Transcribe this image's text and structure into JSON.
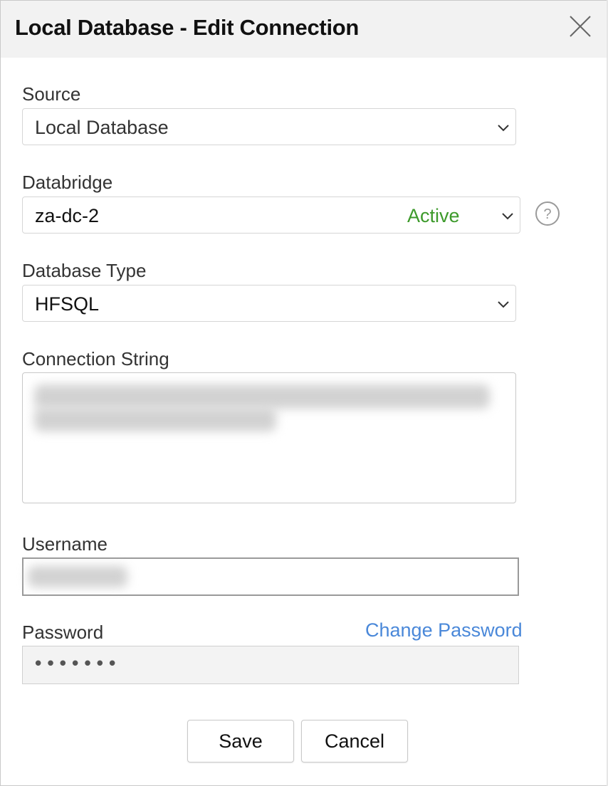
{
  "dialog": {
    "title": "Local Database - Edit Connection"
  },
  "icons": {
    "close": "close-icon",
    "chevron": "chevron-down-icon",
    "help": "help-icon"
  },
  "fields": {
    "source": {
      "label": "Source",
      "value": "Local Database"
    },
    "databridge": {
      "label": "Databridge",
      "value": "za-dc-2",
      "status": "Active"
    },
    "database_type": {
      "label": "Database Type",
      "value": "HFSQL"
    },
    "connection_string": {
      "label": "Connection String"
    },
    "username": {
      "label": "Username"
    },
    "password": {
      "label": "Password",
      "masked_value": "•••••••",
      "change_link": "Change Password"
    }
  },
  "buttons": {
    "save": "Save",
    "cancel": "Cancel"
  },
  "colors": {
    "status_active": "#3d9a2b",
    "link": "#4a88d9",
    "header_bg": "#f2f2f2"
  }
}
